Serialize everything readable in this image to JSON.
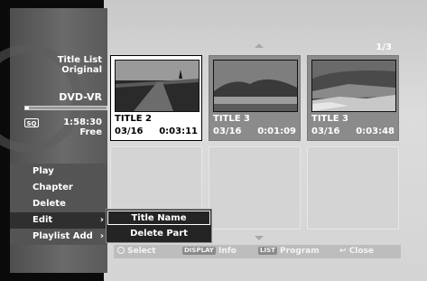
{
  "left_panel": {
    "title_line1": "Title List",
    "title_line2": "Original",
    "media": "DVD-VR",
    "mode_icon": "SQ",
    "time": "1:58:30",
    "free_label": "Free",
    "capacity_used_fraction": 0.04
  },
  "menu": {
    "items": [
      "Play",
      "Chapter",
      "Delete",
      "Edit",
      "Playlist Add"
    ],
    "edit_arrow": "›",
    "playlist_arrow": "›"
  },
  "submenu": {
    "items": [
      "Title Name",
      "Delete Part"
    ]
  },
  "page_indicator": "1/3",
  "thumbnails": [
    {
      "title": "TITLE 2",
      "date": "03/16",
      "length": "0:03:11",
      "selected": true
    },
    {
      "title": "TITLE 3",
      "date": "03/16",
      "length": "0:01:09",
      "selected": false
    },
    {
      "title": "TITLE 3",
      "date": "03/16",
      "length": "0:03:48",
      "selected": false
    }
  ],
  "bottom_bar": {
    "select_label": "Select",
    "display_key": "DISPLAY",
    "info_label": "Info",
    "list_key": "LIST",
    "program_label": "Program",
    "close_label": "Close"
  },
  "colors": {
    "highlight": "#ffffff",
    "menu_bg": "#545454",
    "panel_bg": "#d4d4d4"
  }
}
